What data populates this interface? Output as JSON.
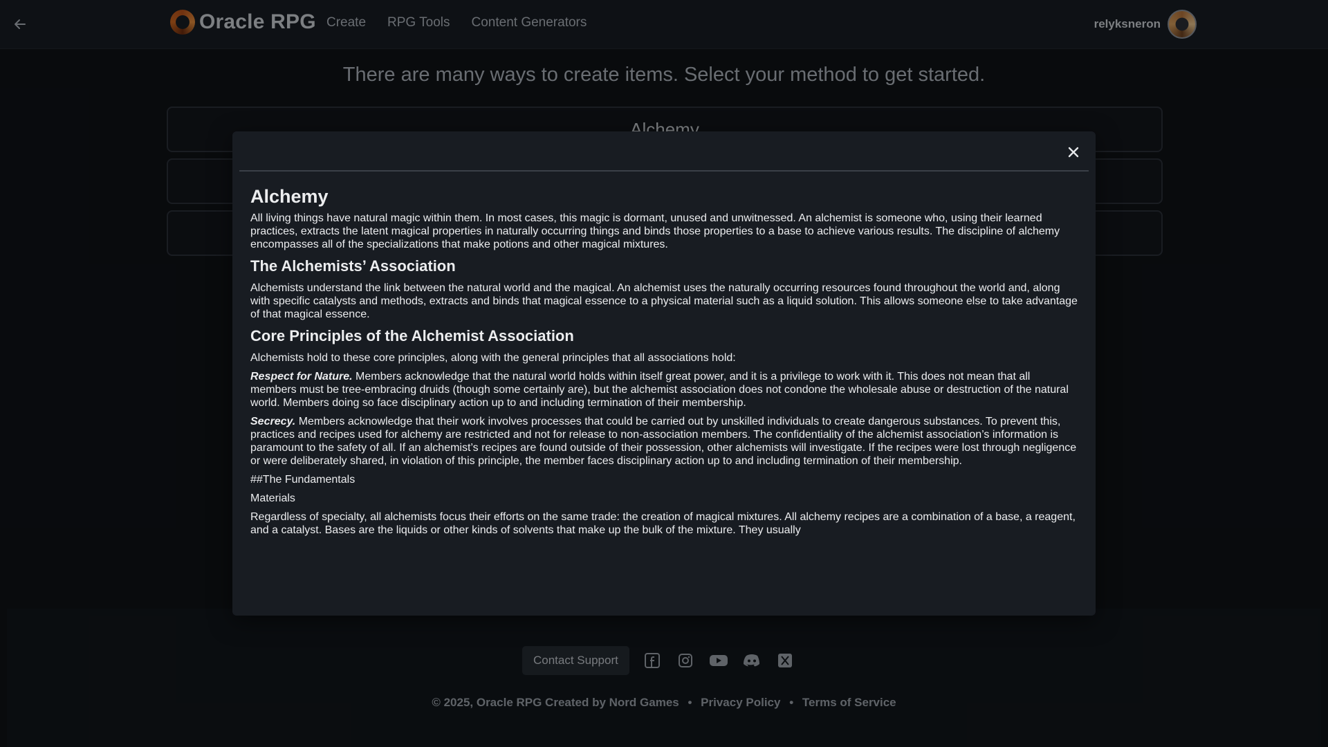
{
  "header": {
    "brand": "Oracle RPG",
    "nav": [
      "Create",
      "RPG Tools",
      "Content Generators"
    ],
    "username": "relyksneron"
  },
  "page": {
    "heading": "There are many ways to create items. Select your method to get started.",
    "cards": [
      "Alchemy",
      "",
      ""
    ]
  },
  "modal": {
    "title": "Alchemy",
    "intro": "All living things have natural magic within them. In most cases, this magic is dormant, unused and unwitnessed.  An alchemist is someone who, using their learned practices, extracts the latent magical properties in naturally occurring things and binds those properties to a base to achieve various results. The discipline of alchemy encompasses all of the specializations that make potions and other magical mixtures.",
    "h2_association": "The Alchemists’ Association",
    "association_text": "Alchemists understand the link between the natural world and the magical. An alchemist uses the naturally occurring resources found throughout the world and, along with specific catalysts and methods, extracts and binds that magical essence to a physical material such as a liquid solution. This allows someone else to take advantage of that magical essence.",
    "h2_principles": "Core Principles of the Alchemist Association",
    "principles_intro": "Alchemists hold to these core principles, along with the general principles that all associations hold:",
    "respect_label": "Respect for Nature.",
    "respect_text": " Members acknowledge that the natural world holds within itself great power, and it is a privilege to work with it. This does not mean that all members must be tree-embracing druids (though some certainly are), but the alchemist association does not condone the wholesale abuse or destruction of the natural world. Members doing so face disciplinary action up to and including termination of their membership.",
    "secrecy_label": "Secrecy.",
    "secrecy_text": " Members acknowledge that their work involves processes that could be carried out by unskilled individuals to create dangerous substances. To prevent this, practices and recipes used for alchemy are restricted and not for release to non-association members. The confidentiality of the alchemist association’s information is paramount to the safety of all. If an alchemist’s recipes are found outside of their possession, other alchemists will investigate. If the recipes were lost through negligence or were deliberately shared, in violation of this principle, the member faces disciplinary action up to and including termination of their membership.",
    "fundamentals": "##The Fundamentals",
    "materials": "Materials",
    "materials_text": "Regardless of specialty, all alchemists focus their efforts on the same trade: the creation of magical mixtures. All alchemy recipes are a combination of a base, a reagent, and a catalyst. Bases are the liquids or other kinds of solvents that make up the bulk of the mixture. They usually"
  },
  "footer": {
    "support": "Contact Support",
    "socials": [
      "facebook-icon",
      "instagram-icon",
      "youtube-icon",
      "discord-icon",
      "x-icon"
    ],
    "copyright": "© 2025, Oracle RPG Created by Nord Games",
    "privacy": "Privacy Policy",
    "terms": "Terms of Service"
  },
  "colors": {
    "background": "#0f1216",
    "header": "#181c22",
    "modal": "#181c22",
    "text": "#e6e8eb"
  }
}
